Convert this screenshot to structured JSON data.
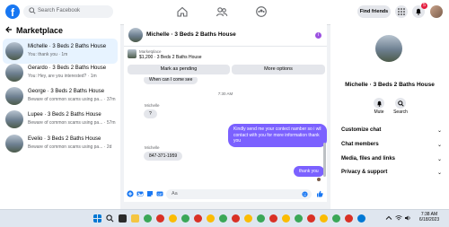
{
  "topbar": {
    "logo": "f",
    "search_placeholder": "Search Facebook",
    "find_friends_label": "Find friends",
    "notification_count": "5"
  },
  "sidebar": {
    "title": "Marketplace",
    "conversations": [
      {
        "title": "Michelle · 3 Beds 2 Baths House",
        "subtitle": "You: thank you · 1m",
        "active": true
      },
      {
        "title": "Gerardo · 3 Beds 2 Baths House",
        "subtitle": "You: Hey, are you interested? · 1m",
        "active": false
      },
      {
        "title": "George · 3 Beds 2 Baths House",
        "subtitle": "Beware of common scams using pa... · 37m",
        "active": false
      },
      {
        "title": "Lupee · 3 Beds 2 Baths House",
        "subtitle": "Beware of common scams using pa... · 57m",
        "active": false
      },
      {
        "title": "Evelio · 3 Beds 2 Baths House",
        "subtitle": "Beware of common scams using pa... · 2d",
        "active": false
      }
    ]
  },
  "chat": {
    "title": "Michelle · 3 Beds 2 Baths House",
    "listing_label": "Marketplace",
    "listing_price_title": "$1,200 · 3 Beds 2 Baths House",
    "mark_pending_label": "Mark as pending",
    "more_options_label": "More options",
    "messages": {
      "m1": "When can I come see",
      "ts": "7:30 AM",
      "sender1": "Michelle",
      "m2": "?",
      "out1": "Kindly send me your contect namber so i wil contact with you for more information thank you",
      "sender2": "Michelle",
      "m3": "847-371-1959",
      "out2": "thank you"
    },
    "composer_placeholder": "Aa"
  },
  "details": {
    "name": "Michelle · 3 Beds 2 Baths House",
    "mute_label": "Mute",
    "search_label": "Search",
    "sections": [
      "Customize chat",
      "Chat members",
      "Media, files and links",
      "Privacy & support"
    ]
  },
  "taskbar": {
    "time": "7:38 AM",
    "date": "6/18/2023"
  }
}
